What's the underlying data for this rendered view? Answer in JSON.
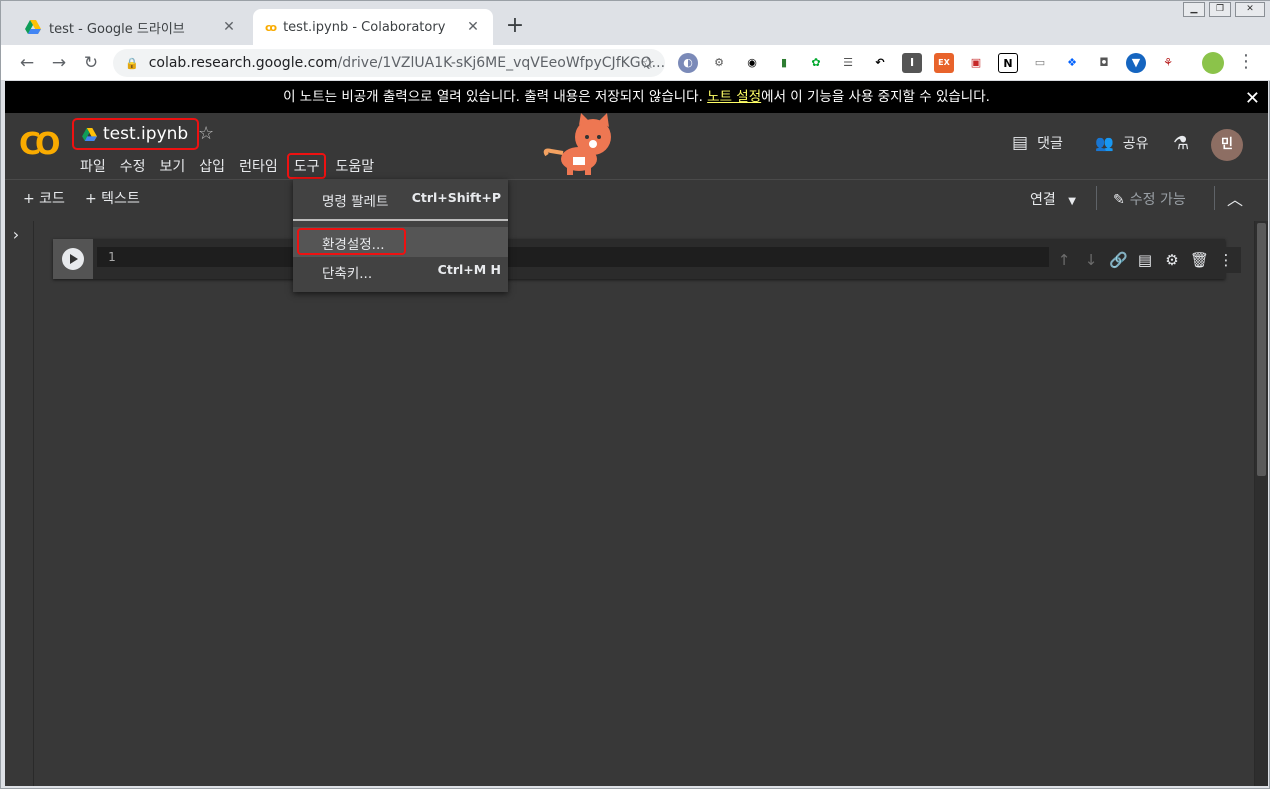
{
  "browser": {
    "tabs": [
      {
        "title": "test - Google 드라이브",
        "icon": "google-drive-icon"
      },
      {
        "title": "test.ipynb - Colaboratory",
        "icon": "colab-icon"
      }
    ],
    "url_host": "colab.research.google.com",
    "url_path": "/drive/1VZlUA1K-sKj6ME_vqVEeoWfpyCJfKGQ..."
  },
  "banner": {
    "text_before": "이 노트는 비공개 출력으로 열려 있습니다. 출력 내용은 저장되지 않습니다. ",
    "link": "노트 설정",
    "text_after": "에서 이 기능을 사용 중지할 수 있습니다."
  },
  "colab": {
    "logo": "CO",
    "notebook_title": "test.ipynb",
    "menu": [
      "파일",
      "수정",
      "보기",
      "삽입",
      "런타임",
      "도구",
      "도움말"
    ],
    "comment_label": "댓글",
    "share_label": "공유",
    "avatar_initial": "민",
    "add_code": "+ 코드",
    "add_text": "+ 텍스트",
    "connect_label": "연결",
    "edit_label": "수정 가능",
    "line_number": "1"
  },
  "tools_menu": {
    "items": [
      {
        "label": "명령 팔레트",
        "shortcut": "Ctrl+Shift+P"
      },
      {
        "label": "환경설정...",
        "shortcut": ""
      },
      {
        "label": "단축키...",
        "shortcut": "Ctrl+M H"
      }
    ]
  },
  "colors": {
    "accent_red": "#ee1111",
    "colab_orange": "#f9ab00",
    "page_bg": "#383838"
  }
}
